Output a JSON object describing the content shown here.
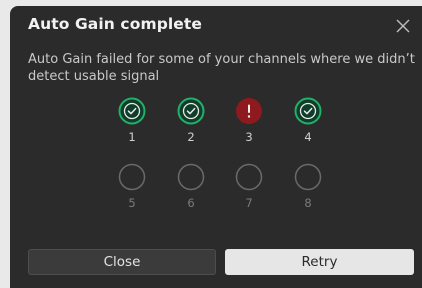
{
  "dialog": {
    "title": "Auto Gain complete",
    "message": "Auto Gain failed for some of your channels where we didn’t detect usable signal",
    "close_icon": "close-icon"
  },
  "channels": [
    {
      "label": "1",
      "status": "success",
      "icon": "check-icon"
    },
    {
      "label": "2",
      "status": "success",
      "icon": "check-icon"
    },
    {
      "label": "3",
      "status": "failed",
      "icon": "exclamation-icon"
    },
    {
      "label": "4",
      "status": "success",
      "icon": "check-icon"
    },
    {
      "label": "5",
      "status": "inactive",
      "icon": "empty-circle-icon"
    },
    {
      "label": "6",
      "status": "inactive",
      "icon": "empty-circle-icon"
    },
    {
      "label": "7",
      "status": "inactive",
      "icon": "empty-circle-icon"
    },
    {
      "label": "8",
      "status": "inactive",
      "icon": "empty-circle-icon"
    }
  ],
  "buttons": {
    "close_label": "Close",
    "retry_label": "Retry"
  },
  "colors": {
    "success": "#22b06a",
    "failed": "#8e1a1f",
    "inactive": "#6a6a6a"
  }
}
